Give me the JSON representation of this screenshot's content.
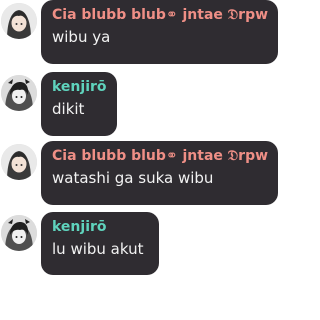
{
  "colors": {
    "bubble_bg": "#2f2c31",
    "name_user_a": "#ef8f86",
    "name_user_b": "#5fd3bd",
    "message_text": "#f2f2f2"
  },
  "messages": [
    {
      "author": "Cia blubb blub⚭ jntae 𝔇rpw",
      "author_color": "#ef8f86",
      "avatar": "avatar-anime-girl",
      "text": "wibu ya"
    },
    {
      "author": "kenjirō",
      "author_color": "#5fd3bd",
      "avatar": "avatar-anime-boy",
      "text": "dikit"
    },
    {
      "author": "Cia blubb blub⚭ jntae 𝔇rpw",
      "author_color": "#ef8f86",
      "avatar": "avatar-anime-girl",
      "text": "watashi ga suka wibu"
    },
    {
      "author": "kenjirō",
      "author_color": "#5fd3bd",
      "avatar": "avatar-anime-boy",
      "text": "lu wibu akut"
    }
  ]
}
